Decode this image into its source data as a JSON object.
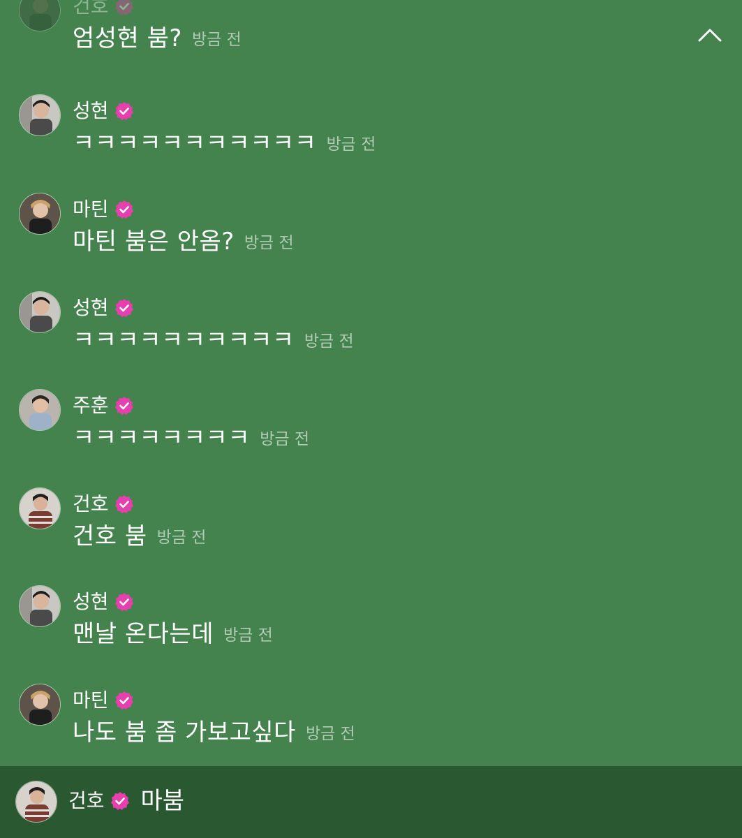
{
  "colors": {
    "background": "#44834d",
    "current_bar": "#2a5830",
    "badge": "#e63fae",
    "time_text": "#b5ccb8"
  },
  "icons": {
    "badge": "verified-badge-icon",
    "collapse": "chevron-up-icon"
  },
  "messages": [
    {
      "name": "건호",
      "text": "엄성현 붐?",
      "time": "방금 전"
    },
    {
      "name": "성현",
      "text": "ㅋㅋㅋㅋㅋㅋㅋㅋㅋㅋㅋ",
      "time": "방금 전"
    },
    {
      "name": "마틴",
      "text": "마틴 붐은 안옴?",
      "time": "방금 전"
    },
    {
      "name": "성현",
      "text": "ㅋㅋㅋㅋㅋㅋㅋㅋㅋㅋ",
      "time": "방금 전"
    },
    {
      "name": "주훈",
      "text": "ㅋㅋㅋㅋㅋㅋㅋㅋ",
      "time": "방금 전"
    },
    {
      "name": "건호",
      "text": "건호 붐",
      "time": "방금 전"
    },
    {
      "name": "성현",
      "text": "맨날 온다는데",
      "time": "방금 전"
    },
    {
      "name": "마틴",
      "text": "나도 붐 좀 가보고싶다",
      "time": "방금 전"
    }
  ],
  "current": {
    "name": "건호",
    "text": "마붐"
  }
}
